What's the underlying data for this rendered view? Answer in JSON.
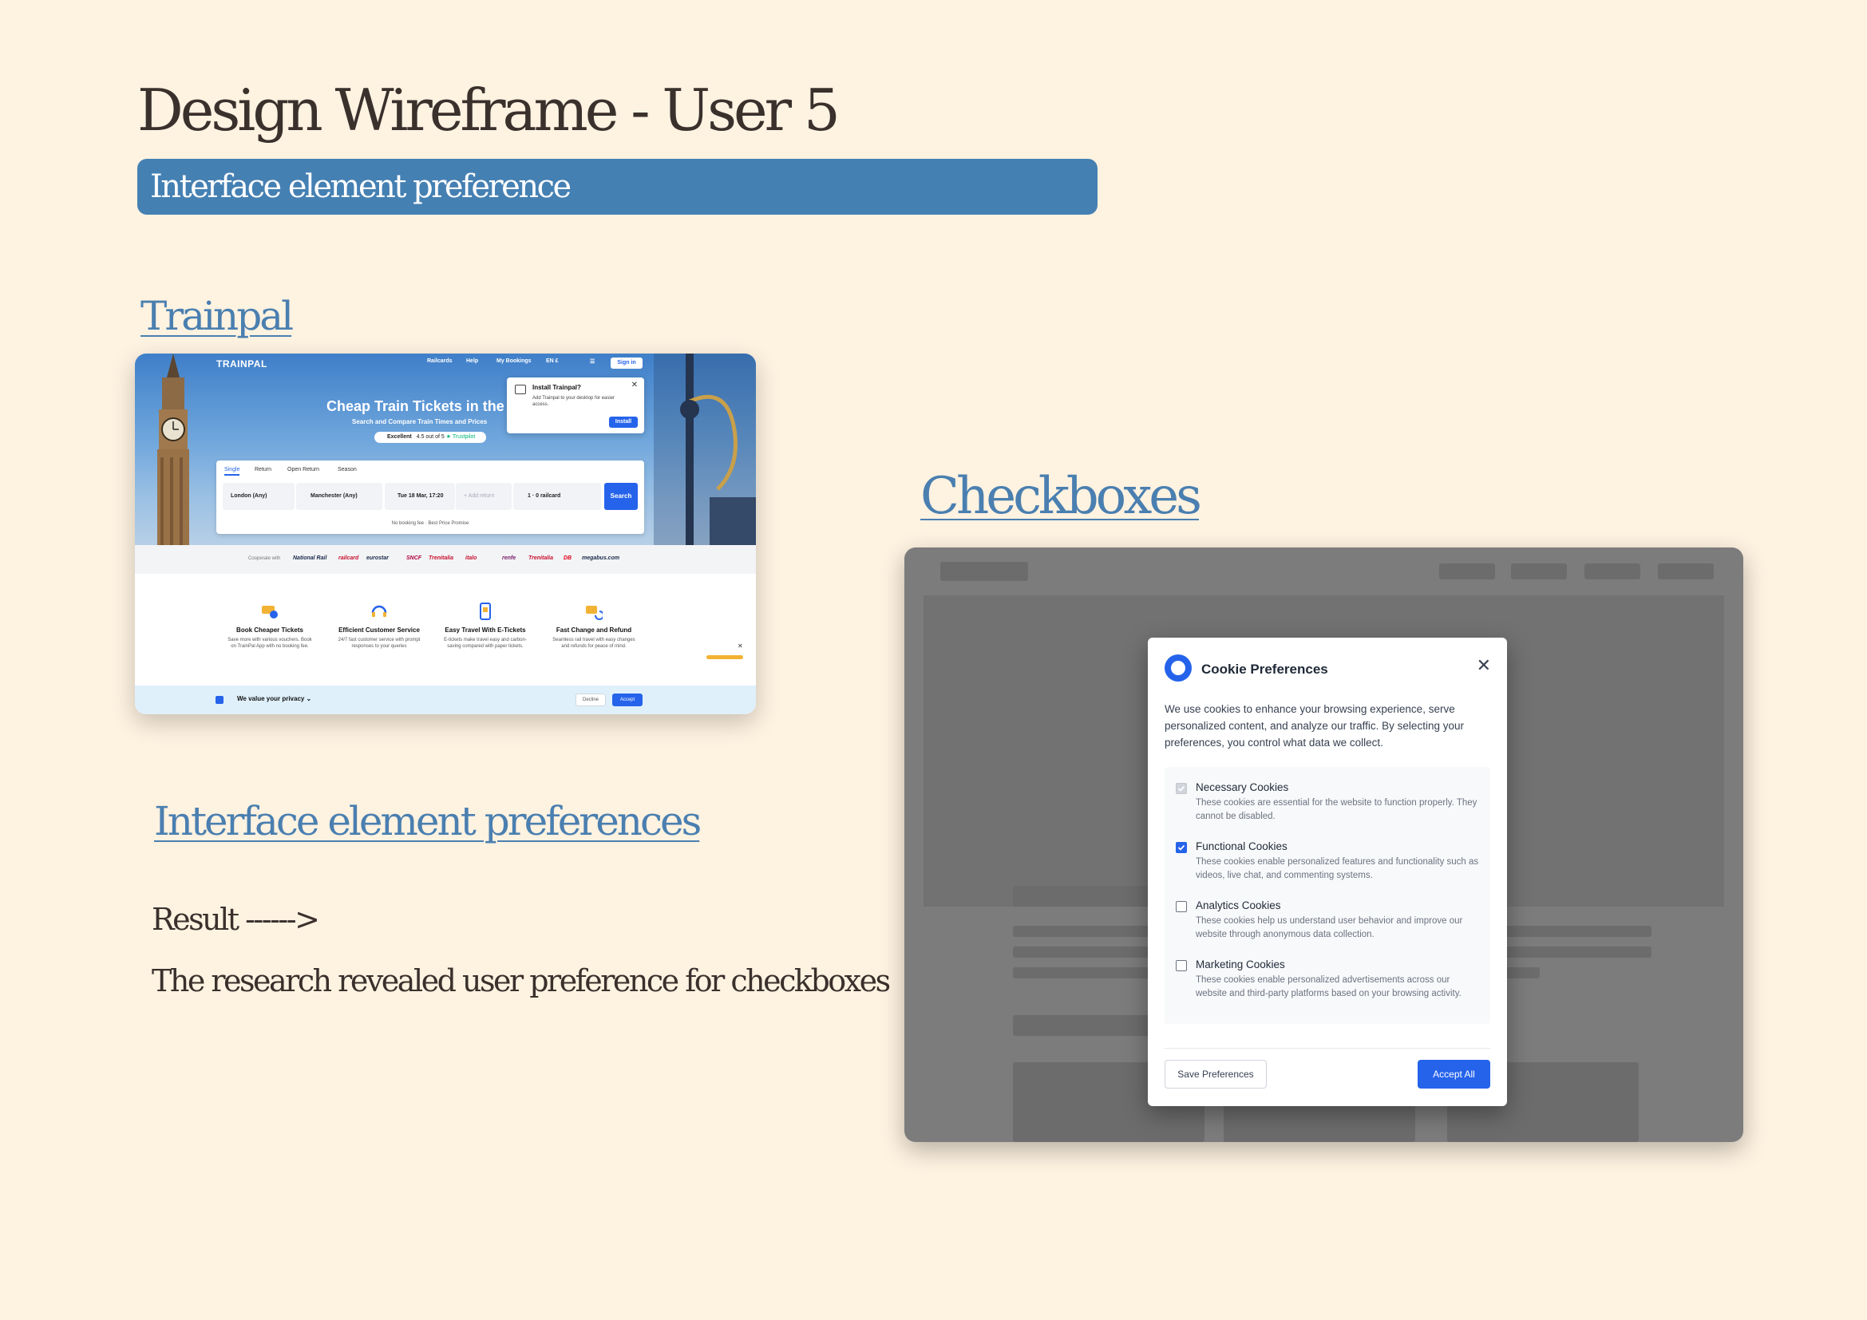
{
  "page": {
    "title": "Design Wireframe - User 5",
    "banner": "Interface element preference",
    "trainpal_heading": "Trainpal",
    "checkboxes_heading": "Checkboxes",
    "preferences_heading": "Interface element preferences",
    "result": "Result ------>",
    "conclusion": "The research revealed user preference for checkboxes"
  },
  "trainpal": {
    "logo": "TRAINPAL",
    "nav": [
      "Railcards",
      "Help",
      "My Bookings",
      "EN £",
      "☰"
    ],
    "sign_in": "Sign in",
    "hero_title": "Cheap Train Tickets in the",
    "hero_subtitle": "Search and Compare Train Times and Prices",
    "rating_label": "Excellent",
    "rating_text": "4.5 out of 5",
    "rating_source": "★ Trustpilot",
    "install_popup": {
      "title": "Install Trainpal?",
      "body": "Add Trainpal to your desktop for easier access.",
      "button": "Install",
      "close": "✕"
    },
    "tabs": [
      "Single",
      "Return",
      "Open Return",
      "Season"
    ],
    "active_tab": "Single",
    "fields": {
      "from": "London (Any)",
      "to": "Manchester (Any)",
      "date": "Tue 18 Mar, 17:20",
      "return": "+ Add return",
      "passengers": "1 · 0 railcard"
    },
    "search_button": "Search",
    "no_fee": "No booking fee · Best Price Promise",
    "partners_label": "Cooperate with",
    "partners": [
      "National Rail",
      "railcard",
      "eurostar",
      "SNCF",
      "Trenitalia",
      "italo",
      "renfe",
      "Trenitalia",
      "DB",
      "megabus.com"
    ],
    "features": [
      {
        "title": "Book Cheaper Tickets",
        "desc": "Save more with various vouchers. Book on TrainPal App with no booking fee."
      },
      {
        "title": "Efficient Customer Service",
        "desc": "24/7 fast customer service with prompt responses to your queries"
      },
      {
        "title": "Easy Travel With E-Tickets",
        "desc": "E-tickets make travel easy and carbon-saving compared with paper tickets."
      },
      {
        "title": "Fast Change and Refund",
        "desc": "Seamless rail travel with easy changes and refunds for peace of mind."
      }
    ],
    "side_close": "✕",
    "privacy_text": "We value your privacy ⌄",
    "decline": "Decline",
    "accept": "Accept"
  },
  "cookies": {
    "title": "Cookie Preferences",
    "close": "✕",
    "intro": "We use cookies to enhance your browsing experience, serve personalized content, and analyze our traffic. By selecting your preferences, you control what data we collect.",
    "items": [
      {
        "label": "Necessary Cookies",
        "desc": "These cookies are essential for the website to function properly. They cannot be disabled.",
        "checked": true,
        "disabled": true
      },
      {
        "label": "Functional Cookies",
        "desc": "These cookies enable personalized features and functionality such as videos, live chat, and commenting systems.",
        "checked": true,
        "disabled": false
      },
      {
        "label": "Analytics Cookies",
        "desc": "These cookies help us understand user behavior and improve our website through anonymous data collection.",
        "checked": false,
        "disabled": false
      },
      {
        "label": "Marketing Cookies",
        "desc": "These cookies enable personalized advertisements across our website and third-party platforms based on your browsing activity.",
        "checked": false,
        "disabled": false
      }
    ],
    "save_button": "Save Preferences",
    "accept_button": "Accept All",
    "accent": "#2563eb"
  },
  "colors": {
    "background": "#fef2e1",
    "banner": "#4580b3",
    "link": "#4a7fb0",
    "overlay": "#7c7c7c"
  }
}
